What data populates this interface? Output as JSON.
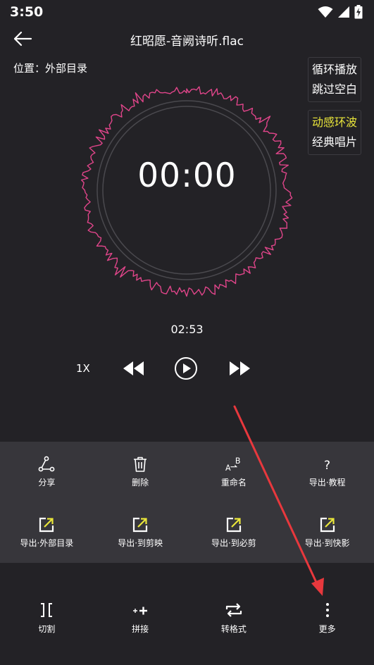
{
  "status_bar": {
    "time": "3:50",
    "icons": [
      "wifi-icon",
      "cell-signal-icon",
      "battery-charging-icon"
    ]
  },
  "header": {
    "back_icon": "back-arrow-icon",
    "title": "红昭愿-音阙诗听.flac"
  },
  "location": "位置：外部目录",
  "options": {
    "playback": [
      "循环播放",
      "跳过空白"
    ],
    "display": [
      "动感环波",
      "经典唱片"
    ],
    "active_display_index": 0
  },
  "player": {
    "current_time": "00:00",
    "duration": "02:53",
    "speed": "1X",
    "waveform_color": "#e0458a",
    "ring_color": "#4a494e"
  },
  "actions": [
    {
      "icon": "share-icon",
      "label": "分享"
    },
    {
      "icon": "trash-icon",
      "label": "删除"
    },
    {
      "icon": "rename-icon",
      "label": "重命名"
    },
    {
      "icon": "help-icon",
      "label": "导出·教程"
    },
    {
      "icon": "export-icon",
      "label": "导出·外部目录"
    },
    {
      "icon": "export-icon",
      "label": "导出·到剪映"
    },
    {
      "icon": "export-icon",
      "label": "导出·到必剪"
    },
    {
      "icon": "export-icon",
      "label": "导出·到快影"
    }
  ],
  "toolbar": [
    {
      "icon": "cut-icon",
      "label": "切割"
    },
    {
      "icon": "merge-icon",
      "label": "拼接"
    },
    {
      "icon": "convert-icon",
      "label": "转格式"
    },
    {
      "icon": "more-vertical-icon",
      "label": "更多"
    }
  ],
  "colors": {
    "background": "#232226",
    "panel": "#37363b",
    "accent_yellow": "#e9e53a",
    "annotation_red": "#e8383d"
  }
}
